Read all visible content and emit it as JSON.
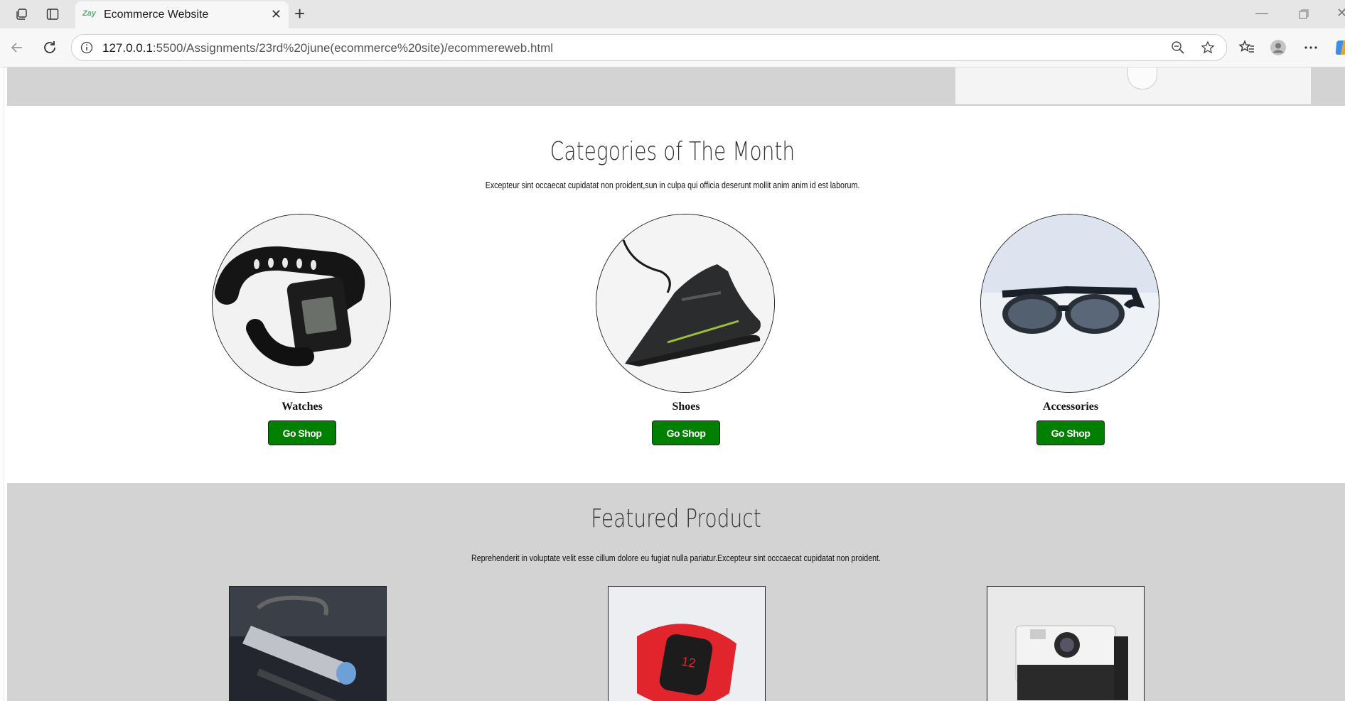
{
  "browser": {
    "tab_title": "Ecommerce Website",
    "tab_favicon_text": "Zay",
    "url_host": "127.0.0.1",
    "url_rest": ":5500/Assignments/23rd%20june(ecommerce%20site)/ecommereweb.html"
  },
  "categories": {
    "title": "Categories of The Month",
    "subtitle": "Excepteur sint occaecat cupidatat non proident,sun in culpa qui officia deserunt mollit anim anim id est laborum.",
    "items": [
      {
        "name": "Watches",
        "button": "Go Shop"
      },
      {
        "name": "Shoes",
        "button": "Go Shop"
      },
      {
        "name": "Accessories",
        "button": "Go Shop"
      }
    ]
  },
  "featured": {
    "title": "Featured Product",
    "subtitle": "Reprehenderit in voluptate velit esse cillum dolore eu fugiat nulla pariatur.Excepteur sint occcaecat cupidatat non proident."
  },
  "colors": {
    "button_green": "#008000",
    "section_gray": "#d3d3d3",
    "favicon_green": "#59ab6e"
  },
  "icons": [
    "collections-icon",
    "sidebar-icon",
    "close-icon",
    "plus-icon",
    "back-icon",
    "refresh-icon",
    "info-icon",
    "zoom-out-icon",
    "star-icon",
    "favorites-icon",
    "profile-icon",
    "more-icon",
    "copilot-icon"
  ]
}
